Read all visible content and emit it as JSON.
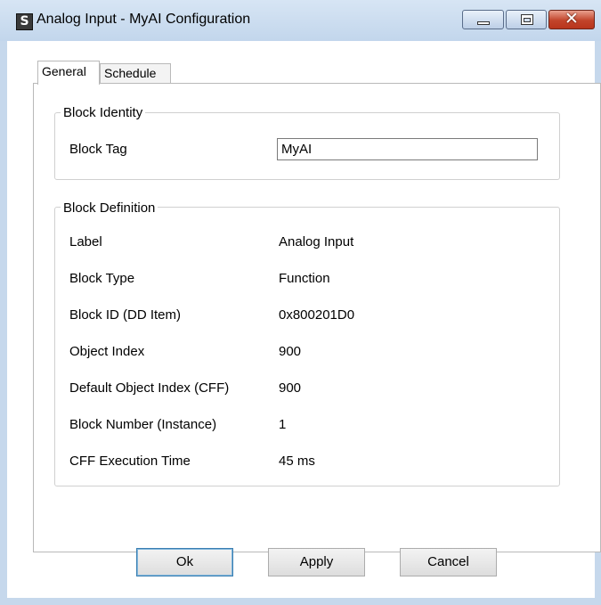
{
  "window": {
    "title": "Analog Input -  MyAI Configuration",
    "app_icon_glyph": "S",
    "close_glyph": "✕"
  },
  "tabs": [
    {
      "label": "General",
      "selected": true
    },
    {
      "label": "Schedule",
      "selected": false
    }
  ],
  "block_identity": {
    "legend": "Block Identity",
    "tag_label": "Block Tag",
    "tag_value": "MyAI"
  },
  "block_definition": {
    "legend": "Block Definition",
    "rows": [
      {
        "label": "Label",
        "value": "Analog Input"
      },
      {
        "label": "Block Type",
        "value": "Function"
      },
      {
        "label": "Block ID (DD Item)",
        "value": "0x800201D0"
      },
      {
        "label": "Object Index",
        "value": "900"
      },
      {
        "label": "Default Object Index (CFF)",
        "value": "900"
      },
      {
        "label": "Block Number (Instance)",
        "value": "1"
      },
      {
        "label": "CFF Execution Time",
        "value": "45 ms"
      }
    ]
  },
  "buttons": {
    "ok": "Ok",
    "apply": "Apply",
    "cancel": "Cancel"
  },
  "colors": {
    "close_button": "#c2442a",
    "default_button_border": "#3c7fb1"
  }
}
